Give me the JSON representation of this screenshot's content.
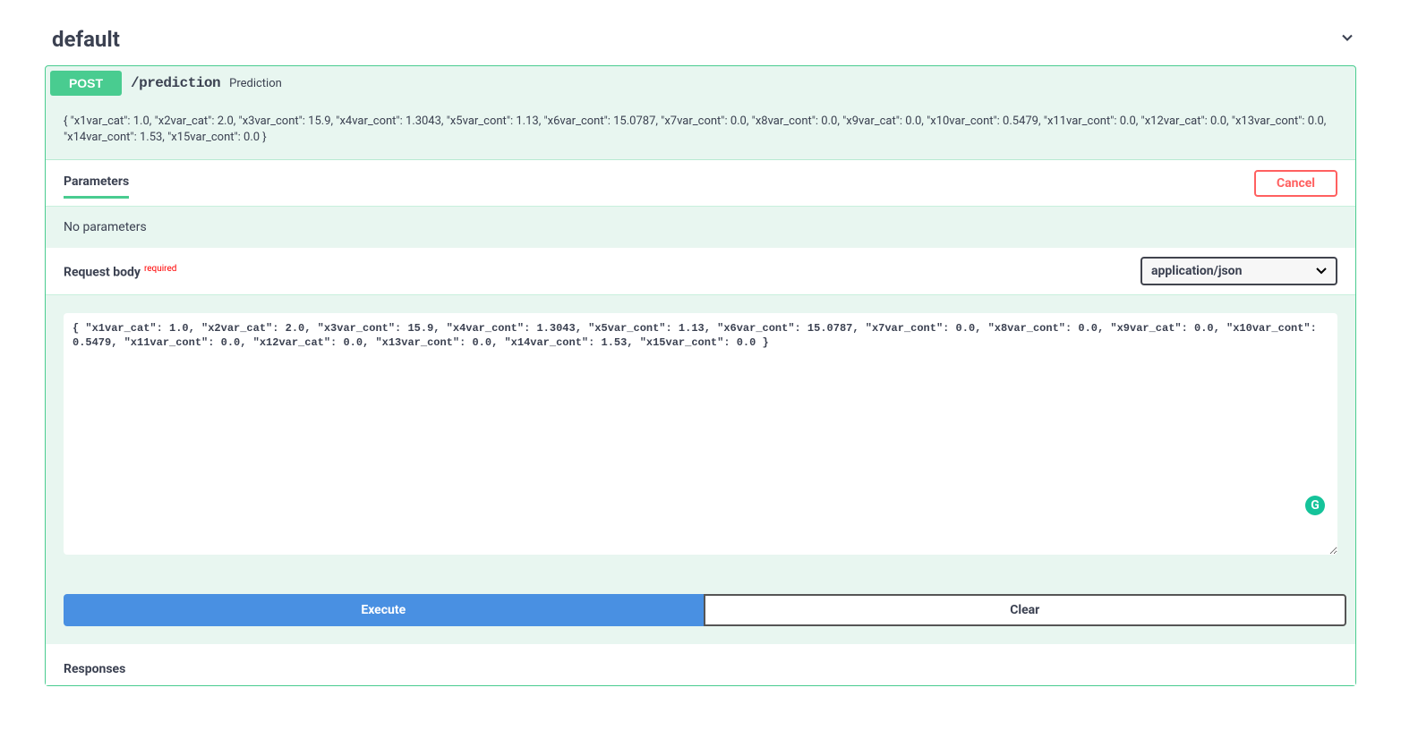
{
  "tag": {
    "name": "default"
  },
  "operation": {
    "method": "POST",
    "path": "/prediction",
    "summary": "Prediction",
    "description": "{ \"x1var_cat\": 1.0, \"x2var_cat\": 2.0, \"x3var_cont\": 15.9, \"x4var_cont\": 1.3043, \"x5var_cont\": 1.13, \"x6var_cont\": 15.0787, \"x7var_cont\": 0.0, \"x8var_cont\": 0.0, \"x9var_cat\": 0.0, \"x10var_cont\": 0.5479, \"x11var_cont\": 0.0, \"x12var_cat\": 0.0, \"x13var_cont\": 0.0, \"x14var_cont\": 1.53, \"x15var_cont\": 0.0 }"
  },
  "parameters": {
    "tab_label": "Parameters",
    "cancel_label": "Cancel",
    "empty_text": "No parameters"
  },
  "request_body": {
    "label": "Request body",
    "required_label": "required",
    "content_type": "application/json",
    "value": "{ \"x1var_cat\": 1.0, \"x2var_cat\": 2.0, \"x3var_cont\": 15.9, \"x4var_cont\": 1.3043, \"x5var_cont\": 1.13, \"x6var_cont\": 15.0787, \"x7var_cont\": 0.0, \"x8var_cont\": 0.0, \"x9var_cat\": 0.0, \"x10var_cont\": 0.5479, \"x11var_cont\": 0.0, \"x12var_cat\": 0.0, \"x13var_cont\": 0.0, \"x14var_cont\": 1.53, \"x15var_cont\": 0.0 }"
  },
  "actions": {
    "execute_label": "Execute",
    "clear_label": "Clear"
  },
  "responses": {
    "title": "Responses"
  },
  "badge": {
    "letter": "G"
  }
}
